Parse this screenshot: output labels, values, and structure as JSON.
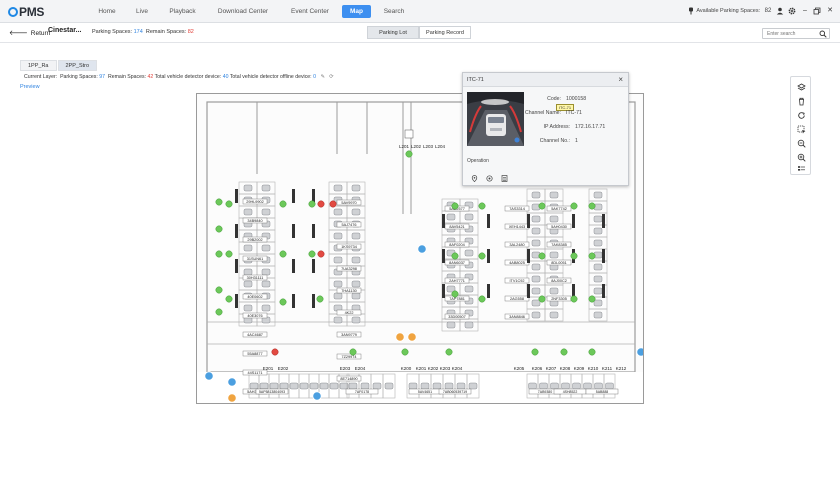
{
  "app": {
    "logo": "PMS",
    "nav": [
      {
        "label": "Home"
      },
      {
        "label": "Live"
      },
      {
        "label": "Playback"
      },
      {
        "label": "Download Center"
      },
      {
        "label": "Event Center"
      },
      {
        "label": "Map",
        "active": true
      },
      {
        "label": "Search"
      }
    ],
    "available_label": "Available Parking Spaces:",
    "available_value": "82"
  },
  "subheader": {
    "return_label": "Return",
    "lot_title": "Cinestar...",
    "parking_spaces_label": "Parking Spaces:",
    "parking_spaces_value": "174",
    "remain_spaces_label": "Remain Spaces:",
    "remain_spaces_value": "82",
    "tabs": [
      {
        "label": "Parking Lot",
        "active": true
      },
      {
        "label": "Parking Record"
      }
    ],
    "search_placeholder": "Enter search"
  },
  "floor_tabs": [
    {
      "label": "1PP_Ra"
    },
    {
      "label": "2PP_Stro",
      "active": true
    }
  ],
  "layer_info": {
    "current_layer_label": "Current Layer:",
    "parking_spaces_label": "Parking Spaces:",
    "parking_spaces_value": "97",
    "remain_spaces_label": "Remain Spaces:",
    "remain_spaces_value": "42",
    "detector_total_label": "Total vehicle detector device:",
    "detector_total_value": "40",
    "detector_offline_label": "Total vehicle detector offline device:",
    "detector_offline_value": "0"
  },
  "preview_label": "Preview",
  "popup": {
    "title": "ITC-71",
    "code_label": "Code:",
    "code_value": "1000158",
    "channel_name_label": "Channel Name:",
    "channel_name_value": "ITC-71",
    "ip_label": "IP Address:",
    "ip_value": "172.16.17.71",
    "channel_no_label": "Channel No.:",
    "channel_no_value": "1",
    "operation_label": "Operation",
    "tag": "ITC-71"
  },
  "map": {
    "bottom_labels": [
      "E201",
      "E202",
      "E203",
      "E204",
      "K200",
      "K201",
      "K202",
      "K203",
      "K204",
      "K205",
      "K206",
      "K207",
      "K208",
      "K209",
      "K210",
      "K211",
      "K212"
    ],
    "top_labels": [
      "L201",
      "L202",
      "L203",
      "L204"
    ],
    "plates_col1": [
      "29HL9902",
      "34B9840",
      "29B2002",
      "31SUN61",
      "30H31111",
      "40E0602",
      "40E3076",
      "4AC4687",
      "55A8877",
      "44S1171",
      "5AH3410",
      "5AX0781"
    ],
    "plates_col2": [
      "5AV9970",
      "5AJ7476",
      "1KS9734",
      "7UA3298",
      "7HA1130",
      "4K22",
      "3AN9779",
      "7Z29974",
      "8E714890"
    ],
    "plates_col3": [
      "5AE2577",
      "7AS3314",
      "5AK7742",
      "8AV5421",
      "XEH1443",
      "5AH0430",
      "8AF0204",
      "3AL2480",
      "7AK8385",
      "8AN6037",
      "4AB8025",
      "8DL0051",
      "2AH7771",
      "ITV1C92",
      "8AJ00C2",
      "7AP7881",
      "2AG558",
      "2NF3305",
      "33D00507",
      "3AN8846"
    ],
    "plates_bottom": [
      "5AP5813804093",
      "7AF0178",
      "5AV4651",
      "7AB060539719",
      "7AB9380",
      "4SH8522",
      "5AB888"
    ]
  }
}
